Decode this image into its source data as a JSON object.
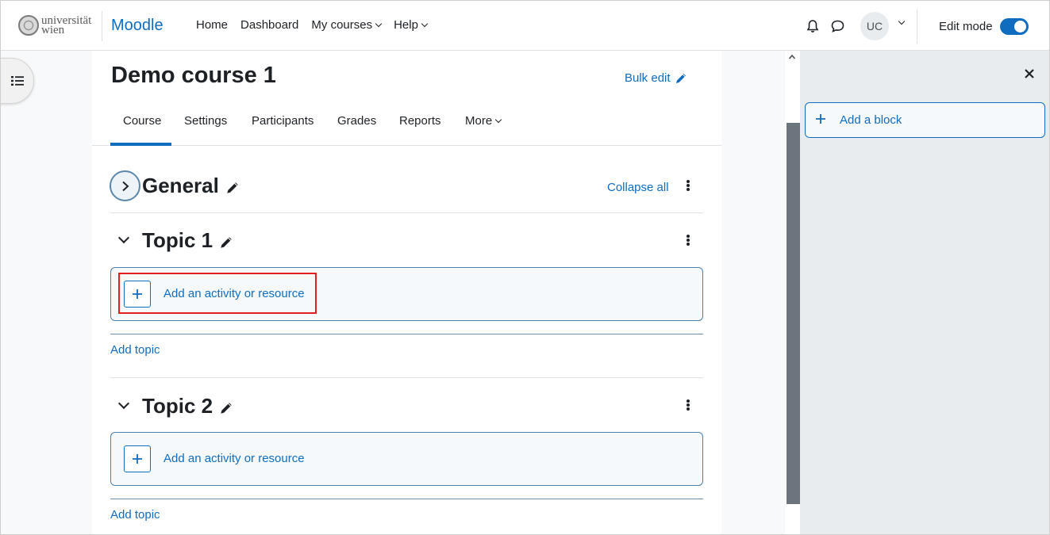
{
  "navbar": {
    "logo_text_line1": "universität",
    "logo_text_line2": "wien",
    "brand": "Moodle",
    "links": [
      {
        "label": "Home"
      },
      {
        "label": "Dashboard"
      },
      {
        "label": "My courses"
      },
      {
        "label": "Help"
      }
    ],
    "avatar_initials": "UC",
    "edit_mode_label": "Edit mode",
    "edit_mode_on": true
  },
  "course": {
    "title": "Demo course 1",
    "bulk_edit": "Bulk edit",
    "tabs": [
      {
        "label": "Course",
        "active": true
      },
      {
        "label": "Settings"
      },
      {
        "label": "Participants"
      },
      {
        "label": "Grades"
      },
      {
        "label": "Reports"
      },
      {
        "label": "More"
      }
    ],
    "collapse_all": "Collapse all",
    "sections": [
      {
        "title": "General"
      },
      {
        "title": "Topic 1",
        "add_activity": "Add an activity or resource",
        "add_topic": "Add topic"
      },
      {
        "title": "Topic 2",
        "add_activity": "Add an activity or resource",
        "add_topic": "Add topic"
      }
    ]
  },
  "right_drawer": {
    "add_block": "Add a block"
  },
  "colors": {
    "accent": "#0f6cbf",
    "highlight": "#e02020"
  }
}
